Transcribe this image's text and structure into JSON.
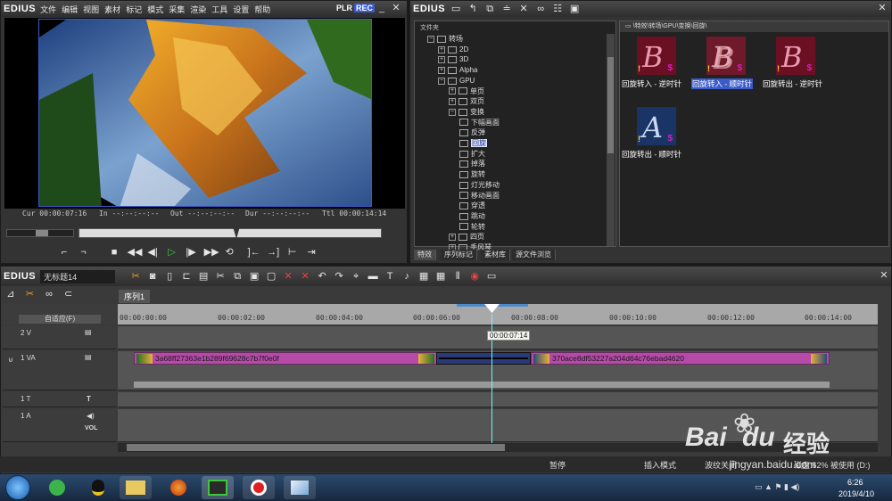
{
  "player": {
    "logo": "EDIUS",
    "menu": [
      "文件",
      "编辑",
      "视图",
      "素材",
      "标记",
      "模式",
      "采集",
      "渲染",
      "工具",
      "设置",
      "帮助"
    ],
    "plr": "PLR",
    "rec": "REC",
    "cur": "Cur 00:00:07:16",
    "in": "In --:--:--:--",
    "out": "Out --:--:--:--",
    "dur": "Dur --:--:--:--",
    "ttl": "Ttl 00:00:14:14"
  },
  "effects": {
    "logo": "EDIUS",
    "tree_header": "文件夹",
    "path": "\\特效\\转场\\GPU\\变换\\回旋\\",
    "tree": [
      {
        "label": "转场",
        "indent": 0,
        "exp": "⊟"
      },
      {
        "label": "2D",
        "indent": 1,
        "exp": "⊞"
      },
      {
        "label": "3D",
        "indent": 1,
        "exp": "⊞"
      },
      {
        "label": "Alpha",
        "indent": 1,
        "exp": "⊞"
      },
      {
        "label": "GPU",
        "indent": 1,
        "exp": "⊟"
      },
      {
        "label": "单页",
        "indent": 2,
        "exp": "⊞"
      },
      {
        "label": "双页",
        "indent": 2,
        "exp": "⊞"
      },
      {
        "label": "变换",
        "indent": 2,
        "exp": "⊟"
      },
      {
        "label": "下幅画面",
        "indent": 3,
        "exp": ""
      },
      {
        "label": "反弹",
        "indent": 3,
        "exp": ""
      },
      {
        "label": "回旋",
        "indent": 3,
        "exp": "",
        "selected": true
      },
      {
        "label": "扩大",
        "indent": 3,
        "exp": ""
      },
      {
        "label": "掉落",
        "indent": 3,
        "exp": ""
      },
      {
        "label": "旋转",
        "indent": 3,
        "exp": ""
      },
      {
        "label": "灯光移动",
        "indent": 3,
        "exp": ""
      },
      {
        "label": "移动画面",
        "indent": 3,
        "exp": ""
      },
      {
        "label": "穿透",
        "indent": 3,
        "exp": ""
      },
      {
        "label": "跳动",
        "indent": 3,
        "exp": ""
      },
      {
        "label": "轮转",
        "indent": 3,
        "exp": ""
      },
      {
        "label": "四页",
        "indent": 2,
        "exp": "⊞"
      },
      {
        "label": "手风琴",
        "indent": 2,
        "exp": "⊞"
      }
    ],
    "items": [
      {
        "label": "回旋转入 - 逆时针",
        "letter": "B"
      },
      {
        "label": "回旋转入 - 顺时针",
        "letter": "B"
      },
      {
        "label": "回旋转出 - 逆时针",
        "letter": "B"
      },
      {
        "label": "回旋转出 - 顺时针",
        "letter": "A"
      }
    ],
    "tabs": [
      "特效",
      "序列标记",
      "素材库",
      "源文件浏览"
    ]
  },
  "timeline": {
    "logo": "EDIUS",
    "project": "无标题14",
    "sequence_tab": "序列1",
    "mode": "自适应(F)",
    "ruler": [
      "00:00:00:00",
      "00:00:02:00",
      "00:00:04:00",
      "00:00:06:00",
      "00:00:08:00",
      "00:00:10:00",
      "00:00:12:00",
      "00:00:14:00"
    ],
    "playhead_time": "00:00:07:14",
    "tracks": {
      "v2": "2 V",
      "va1": "1 VA",
      "t1": "1 T",
      "a1": "1 A",
      "vol": "VOL"
    },
    "clip1": "3a68ff27363e1b289f69628c7b7f0e0f",
    "clip2": "370ace8df53227a204d64c76ebad4620",
    "status": [
      "暂停",
      "插入模式",
      "波纹关闭",
      "磁盘:62% 被使用 (D:)"
    ]
  },
  "taskbar": {
    "time": "6:26",
    "date": "2019/4/10"
  },
  "watermark": {
    "site": "jingyan.baidu.com",
    "brand": "Bai",
    "brand2": "du",
    "jy": "经验"
  },
  "colors": {
    "accent": "#3a5bc8",
    "clip": "#b64aa8",
    "play": "#3ec63e"
  }
}
